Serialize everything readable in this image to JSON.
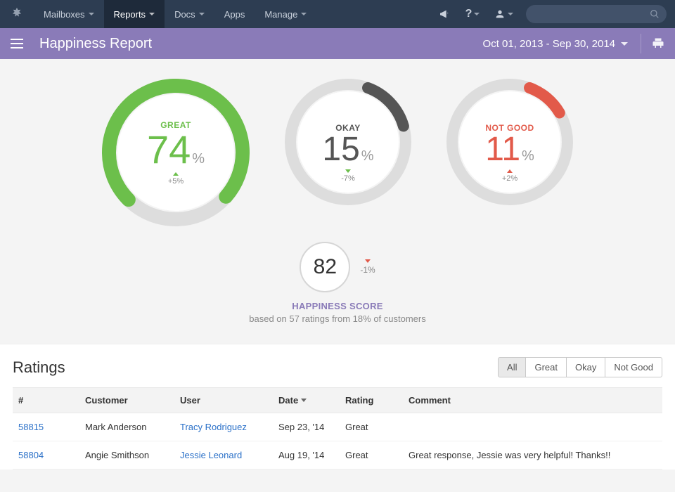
{
  "topnav": {
    "items": [
      {
        "label": "Mailboxes",
        "caret": true
      },
      {
        "label": "Reports",
        "caret": true,
        "active": true
      },
      {
        "label": "Docs",
        "caret": true
      },
      {
        "label": "Apps",
        "caret": false
      },
      {
        "label": "Manage",
        "caret": true
      }
    ]
  },
  "subheader": {
    "title": "Happiness Report",
    "daterange": "Oct 01, 2013 - Sep 30, 2014"
  },
  "chart_data": {
    "type": "pie",
    "title": "Happiness Report",
    "series": [
      {
        "name": "GREAT",
        "value": 74,
        "delta": "+5%",
        "delta_dir": "up",
        "color": "#6cbf4b"
      },
      {
        "name": "OKAY",
        "value": 15,
        "delta": "-7%",
        "delta_dir": "down",
        "color": "#555555"
      },
      {
        "name": "NOT GOOD",
        "value": 11,
        "delta": "+2%",
        "delta_dir": "up",
        "color": "#e25a4a"
      }
    ]
  },
  "score": {
    "value": "82",
    "delta": "-1%",
    "delta_dir": "down",
    "title": "HAPPINESS SCORE",
    "subtitle": "based on 57 ratings from 18% of customers"
  },
  "ratings": {
    "title": "Ratings",
    "filters": [
      "All",
      "Great",
      "Okay",
      "Not Good"
    ],
    "active_filter": 0,
    "columns": [
      "#",
      "Customer",
      "User",
      "Date",
      "Rating",
      "Comment"
    ],
    "sort_col": 3,
    "rows": [
      {
        "id": "58815",
        "customer": "Mark Anderson",
        "user": "Tracy Rodriguez",
        "date": "Sep 23, '14",
        "rating": "Great",
        "comment": ""
      },
      {
        "id": "58804",
        "customer": "Angie Smithson",
        "user": "Jessie Leonard",
        "date": "Aug 19, '14",
        "rating": "Great",
        "comment": "Great response, Jessie was very helpful! Thanks!!"
      }
    ]
  },
  "colors": {
    "accent": "#8a7bb8",
    "green": "#6cbf4b",
    "red": "#e25a4a",
    "ring_bg": "#dddddd"
  }
}
